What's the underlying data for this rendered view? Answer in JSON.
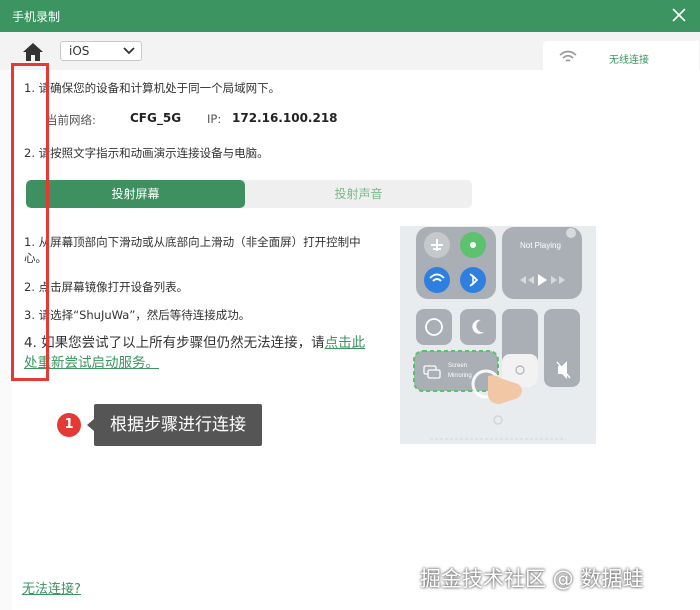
{
  "window": {
    "title": "手机录制"
  },
  "toolbar": {
    "os_select_value": "iOS"
  },
  "side_tab": {
    "label": "无线连接"
  },
  "steps": {
    "step1": "1. 请确保您的设备和计算机处于同一个局域网下。",
    "network_label": "当前网络:",
    "ssid": "CFG_5G",
    "ip_label": "IP:",
    "ip": "172.16.100.218",
    "step2": "2. 请按照文字指示和动画演示连接设备与电脑。"
  },
  "tabs": {
    "active": "投射屏幕",
    "inactive": "投射声音"
  },
  "instructions": {
    "line1a": "1. 从屏幕顶部向下滑动或从底部向上滑动（非全面屏）打开控制中",
    "line1b": "心。",
    "line2": "2. 点击屏幕镜像打开设备列表。",
    "line3": "3. 请选择“ShuJuWa”，然后等待连接成功。",
    "step4_prefix": "4. 如果您尝试了以上所有步骤但仍然无法连接，请",
    "step4_link": "点击此处重新尝试启动服务。"
  },
  "callout": {
    "badge": "1",
    "text": "根据步骤进行连接"
  },
  "phone": {
    "not_playing": "Not Playing",
    "screen_mirroring_1": "Screen",
    "screen_mirroring_2": "Mirroring"
  },
  "footer": {
    "cannot_connect": "无法连接?"
  },
  "watermark": "掘金技术社区 @ 数据蛙",
  "colors": {
    "accent": "#3c9460",
    "highlight": "#e53935",
    "tooltip_bg": "#555555"
  }
}
